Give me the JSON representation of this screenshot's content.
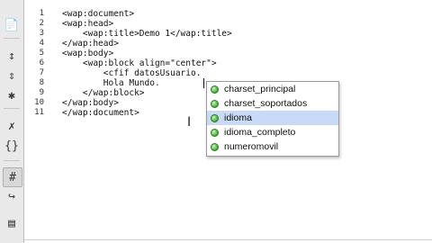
{
  "toolbar": {
    "buttons": [
      {
        "icon": "file-icon"
      },
      {
        "icon": "collapse-icon"
      },
      {
        "icon": "expand-icon"
      },
      {
        "icon": "select-tag-icon"
      },
      {
        "icon": "tag-icon"
      },
      {
        "icon": "braces-icon"
      },
      {
        "icon": "hash-comment-icon"
      },
      {
        "icon": "wrap-icon"
      },
      {
        "icon": "snippet-icon"
      }
    ]
  },
  "editor": {
    "line_numbers": [
      "1",
      "2",
      "3",
      "4",
      "5",
      "6",
      "7",
      "8",
      "9",
      "10",
      "11"
    ],
    "lines": [
      "<wap:document>",
      "<wap:head>",
      "    <wap:title>Demo 1</wap:title>",
      "</wap:head>",
      "<wap:body>",
      "    <wap:block align=\"center\">",
      "        <cfif datosUsuario.",
      "        Hola Mundo.",
      "    </wap:block>",
      "</wap:body>",
      "</wap:document>"
    ]
  },
  "autocomplete": {
    "items": [
      "charset_principal",
      "charset_soportados",
      "idioma",
      "idioma_completo",
      "numeromovil"
    ],
    "selected_index": 2
  }
}
